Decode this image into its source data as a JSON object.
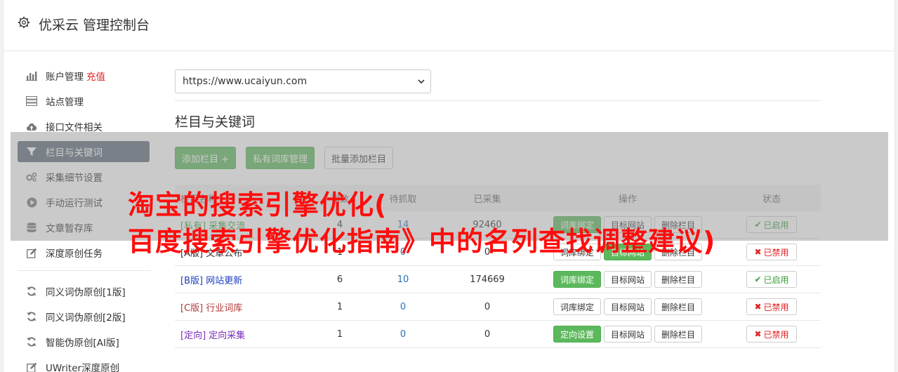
{
  "header": {
    "title": "优采云 管理控制台",
    "icon": "gear-icon"
  },
  "sidebar": {
    "items": [
      {
        "label": "账户管理",
        "badge": "充值",
        "icon": "bar-chart-icon"
      },
      {
        "label": "站点管理",
        "icon": "server-icon"
      },
      {
        "label": "接口文件相关",
        "icon": "cloud-upload-icon"
      },
      {
        "label": "栏目与关键词",
        "icon": "filter-icon",
        "active": true
      },
      {
        "label": "采集细节设置",
        "icon": "cogs-icon"
      },
      {
        "label": "手动运行测试",
        "icon": "play-circle-icon"
      },
      {
        "label": "文章暂存库",
        "icon": "database-icon"
      },
      {
        "label": "深度原创任务",
        "icon": "edit-icon"
      }
    ],
    "items2": [
      {
        "label": "同义词伪原创[1版]",
        "icon": "refresh-icon"
      },
      {
        "label": "同义词伪原创[2版]",
        "icon": "refresh-icon"
      },
      {
        "label": "智能伪原创[AI版]",
        "icon": "refresh-icon"
      },
      {
        "label": "UWriter深度原创",
        "icon": "edit-icon"
      }
    ]
  },
  "main": {
    "site_select": "https://www.ucaiyun.com",
    "section_title": "栏目与关键词",
    "buttons": {
      "add_column": "添加栏目 +",
      "private_lib": "私有词库管理",
      "batch_add": "批量添加栏目"
    },
    "table": {
      "headers": {
        "name": "栏目名称",
        "words": "词数",
        "crawl": "待抓取",
        "collected": "已采集",
        "ops": "操作",
        "status": "状态"
      },
      "rows": [
        {
          "tag": "[私有]",
          "name": "采集交流",
          "words": "4",
          "crawl": "14",
          "collected": "92460",
          "op1": "词库绑定",
          "op2": "目标网站",
          "op3": "删除栏目",
          "status": "已启用"
        },
        {
          "tag": "[A版]",
          "name": "文章公布",
          "words": "1",
          "crawl": "0",
          "collected": "0",
          "op1": "词库绑定",
          "op2": "目标网站",
          "op3": "删除栏目",
          "status": "已禁用"
        },
        {
          "tag": "[B版]",
          "name": "网站更新",
          "words": "6",
          "crawl": "10",
          "collected": "174669",
          "op1": "词库绑定",
          "op2": "目标网站",
          "op3": "删除栏目",
          "status": "已启用"
        },
        {
          "tag": "[C版]",
          "name": "行业词库",
          "words": "1",
          "crawl": "0",
          "collected": "0",
          "op1": "词库绑定",
          "op2": "目标网站",
          "op3": "删除栏目",
          "status": "已禁用"
        },
        {
          "tag": "[定向]",
          "name": "定向采集",
          "words": "1",
          "crawl": "0",
          "collected": "0",
          "op1": "定向设置",
          "op2": "目标网站",
          "op3": "删除栏目",
          "status": "已禁用"
        }
      ]
    }
  },
  "watermark": {
    "line1": "淘宝的搜索引擎优化(",
    "line2": "百度搜索引擎优化指南》中的名列查找调整建议)"
  },
  "colors": {
    "accent_green": "#5cb85c",
    "active_nav": "#5d6b7a",
    "watermark_red": "#ff0d0d"
  }
}
